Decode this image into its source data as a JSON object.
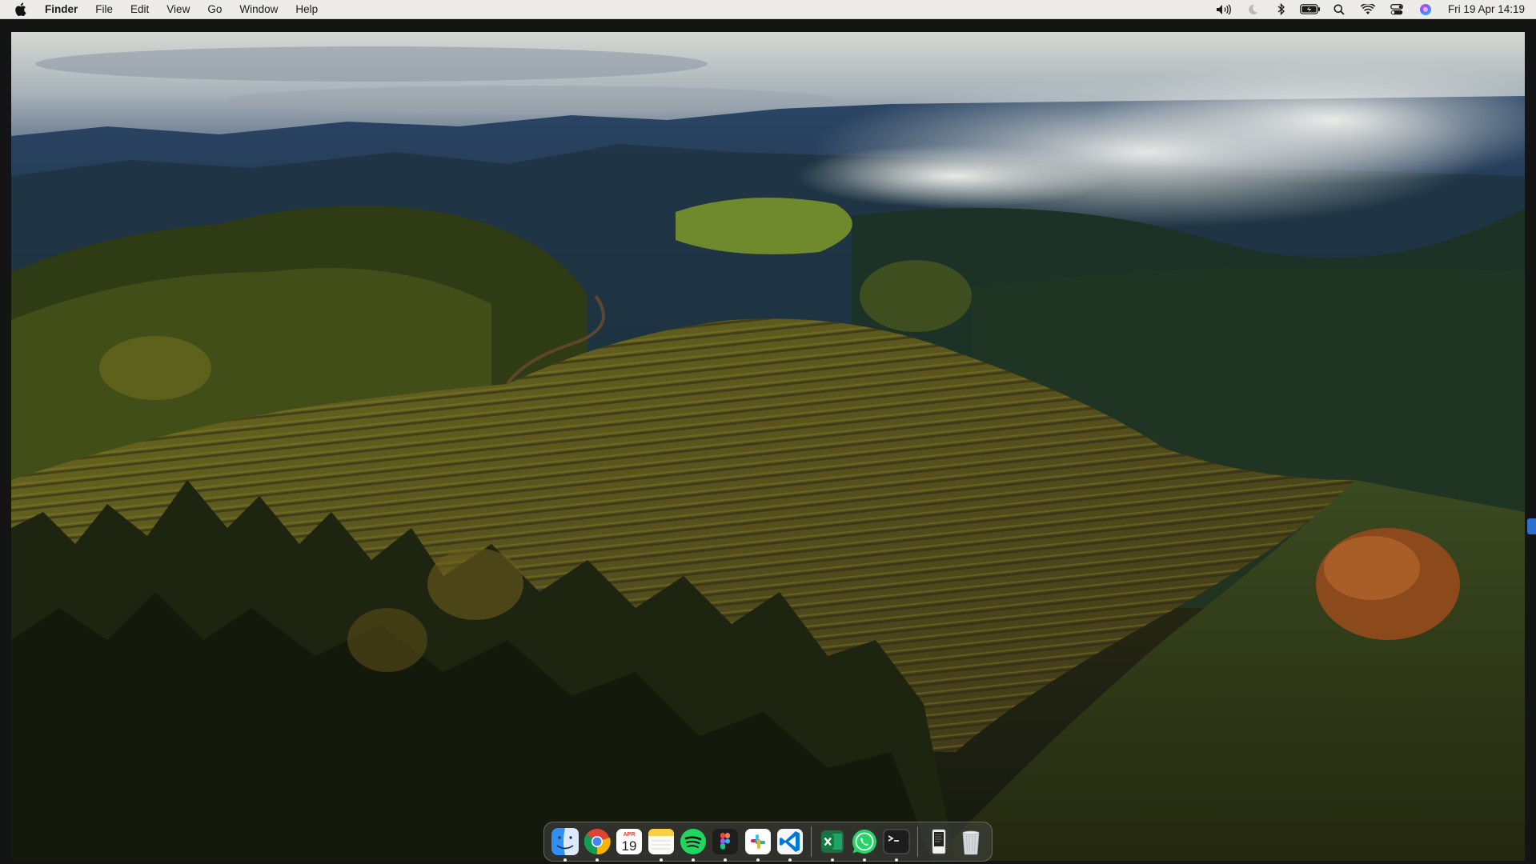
{
  "menubar": {
    "apple_icon": "apple-logo-icon",
    "app_name": "Finder",
    "menus": [
      "File",
      "Edit",
      "View",
      "Go",
      "Window",
      "Help"
    ],
    "status_icons": [
      "volume-icon",
      "focus-moon-icon",
      "bluetooth-icon",
      "battery-icon",
      "spotlight-search-icon",
      "wifi-icon",
      "control-center-icon",
      "siri-icon"
    ],
    "clock": "Fri 19 Apr  14:19"
  },
  "dock": {
    "apps": [
      {
        "name": "Finder",
        "icon": "finder-icon",
        "running": true
      },
      {
        "name": "Google Chrome",
        "icon": "chrome-icon",
        "running": true
      },
      {
        "name": "Calendar",
        "icon": "calendar-icon",
        "running": false,
        "month": "APR",
        "day": "19"
      },
      {
        "name": "Notes",
        "icon": "notes-icon",
        "running": true
      },
      {
        "name": "Spotify",
        "icon": "spotify-icon",
        "running": true
      },
      {
        "name": "Figma",
        "icon": "figma-icon",
        "running": true
      },
      {
        "name": "Slack",
        "icon": "slack-icon",
        "running": true
      },
      {
        "name": "Visual Studio Code",
        "icon": "vscode-icon",
        "running": true
      },
      {
        "name": "Microsoft Excel",
        "icon": "excel-icon",
        "running": true
      },
      {
        "name": "WhatsApp",
        "icon": "whatsapp-icon",
        "running": true
      },
      {
        "name": "Terminal",
        "icon": "terminal-icon",
        "running": true
      },
      {
        "name": "Document",
        "icon": "document-icon",
        "running": false
      },
      {
        "name": "Trash",
        "icon": "trash-icon",
        "running": false
      }
    ]
  },
  "colors": {
    "menubar_bg": "#ecebe8",
    "accent_blue": "#2d6fd0"
  }
}
